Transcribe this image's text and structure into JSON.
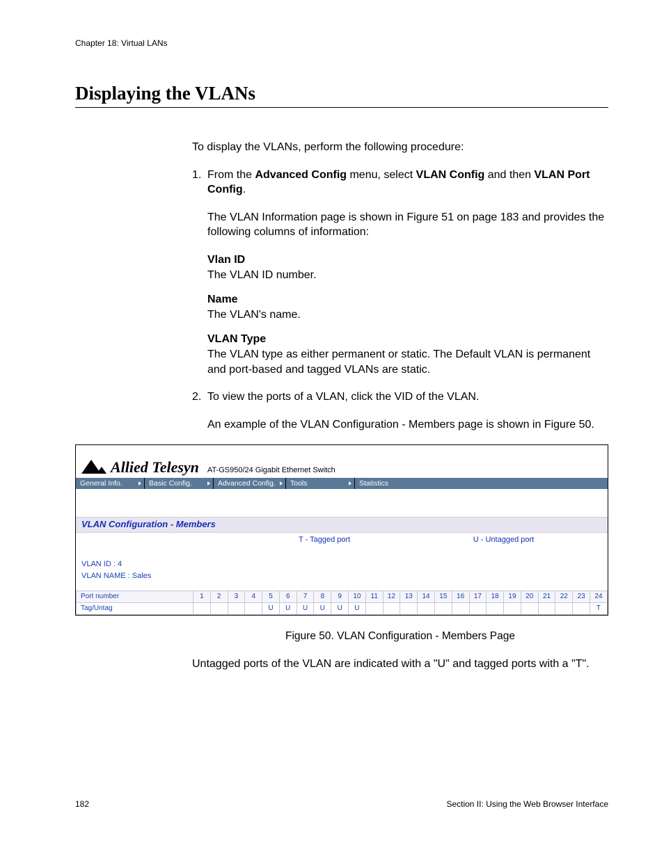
{
  "header": "Chapter 18: Virtual LANs",
  "title": "Displaying the VLANs",
  "intro": "To display the VLANs, perform the following procedure:",
  "steps": {
    "s1_num": "1.",
    "s1_a": "From the ",
    "s1_b": "Advanced Config",
    "s1_c": " menu, select ",
    "s1_d": "VLAN Config",
    "s1_e": " and then ",
    "s1_f": "VLAN Port Config",
    "s1_g": ".",
    "s1_p2": "The VLAN Information page is shown in Figure 51 on page 183 and provides the following columns of information:",
    "s2_num": "2.",
    "s2_a": "To view the ports of a VLAN, click the VID of the VLAN.",
    "s2_p2": "An example of the VLAN Configuration - Members page is shown in Figure 50."
  },
  "defs": {
    "d1t": "Vlan ID",
    "d1d": "The VLAN ID number.",
    "d2t": "Name",
    "d2d": "The VLAN's name.",
    "d3t": "VLAN Type",
    "d3d": "The VLAN type as either permanent or static. The Default VLAN is permanent and port-based and tagged VLANs are static."
  },
  "screenshot": {
    "brand": "Allied Telesyn",
    "brand_sub": "AT-GS950/24 Gigabit Ethernet Switch",
    "menu": [
      "General Info.",
      "Basic Config.",
      "Advanced Config.",
      "Tools",
      "Statistics"
    ],
    "section": "VLAN Configuration - Members",
    "legend_t": "T - Tagged port",
    "legend_u": "U - Untagged port",
    "vlan_id_label": "VLAN ID : 4",
    "vlan_name_label": "VLAN NAME : Sales",
    "row_head_1": "Port number",
    "row_head_2": "Tag/Untag",
    "ports": [
      "1",
      "2",
      "3",
      "4",
      "5",
      "6",
      "7",
      "8",
      "9",
      "10",
      "11",
      "12",
      "13",
      "14",
      "15",
      "16",
      "17",
      "18",
      "19",
      "20",
      "21",
      "22",
      "23",
      "24"
    ],
    "tags": [
      "",
      "",
      "",
      "",
      "U",
      "U",
      "U",
      "U",
      "U",
      "U",
      "",
      "",
      "",
      "",
      "",
      "",
      "",
      "",
      "",
      "",
      "",
      "",
      "",
      "T"
    ]
  },
  "caption": "Figure 50. VLAN Configuration - Members Page",
  "outro": "Untagged ports of the VLAN are indicated with a \"U\" and tagged ports with a \"T\".",
  "footer_left": "182",
  "footer_right": "Section II: Using the Web Browser Interface"
}
